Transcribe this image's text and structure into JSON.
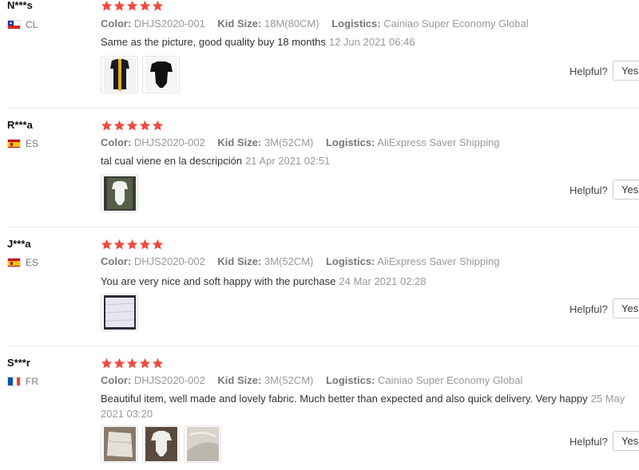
{
  "labels": {
    "color": "Color:",
    "kid_size": "Kid Size:",
    "logistics": "Logistics:",
    "helpful": "Helpful?",
    "yes": "Yes"
  },
  "colors": {
    "star": "#f04a3d",
    "meta_value": "#999999",
    "divider": "#e8e8e8"
  },
  "reviews": [
    {
      "user": "N***s",
      "country": "CL",
      "flag_icon": "chile-flag-icon",
      "rating": 5,
      "color": "DHJS2020-001",
      "kid_size": "18M(80CM)",
      "logistics": "Cainiao Super Economy Global",
      "text": "Same as the picture, good quality buy 18 months",
      "date": "12 Jun 2021 06:46",
      "photos": [
        "photo-bodysuit-measured",
        "photo-bodysuit-black"
      ]
    },
    {
      "user": "R***a",
      "country": "ES",
      "flag_icon": "spain-flag-icon",
      "rating": 5,
      "color": "DHJS2020-002",
      "kid_size": "3M(52CM)",
      "logistics": "AliExpress Saver Shipping",
      "text": "tal cual viene en la descripción",
      "date": "21 Apr 2021 02:51",
      "photos": [
        "photo-bodysuit-white"
      ]
    },
    {
      "user": "J***a",
      "country": "ES",
      "flag_icon": "spain-flag-icon",
      "rating": 5,
      "color": "DHJS2020-002",
      "kid_size": "3M(52CM)",
      "logistics": "AliExpress Saver Shipping",
      "text": "You are very nice and soft happy with the purchase",
      "date": "24 Mar 2021 02:28",
      "photos": [
        "photo-fabric-white"
      ]
    },
    {
      "user": "S***r",
      "country": "FR",
      "flag_icon": "france-flag-icon",
      "rating": 5,
      "color": "DHJS2020-002",
      "kid_size": "3M(52CM)",
      "logistics": "Cainiao Super Economy Global",
      "text": "Beautiful item, well made and lovely fabric. Much better than expected and also quick delivery. Very happy",
      "date": "25 May 2021 03:20",
      "photos": [
        "photo-fabric-folded",
        "photo-bodysuit-laid",
        "photo-fabric-closeup"
      ]
    }
  ]
}
